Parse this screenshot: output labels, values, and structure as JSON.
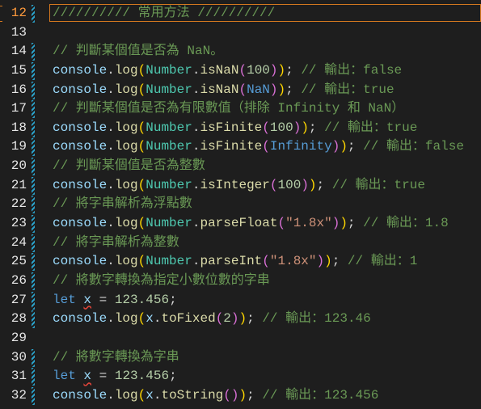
{
  "editor": {
    "current_line": 12,
    "lines": [
      {
        "num": "12",
        "tokens": [
          {
            "t": "////////// 常用方法 //////////",
            "c": "cm"
          }
        ]
      },
      {
        "num": "13",
        "tokens": []
      },
      {
        "num": "14",
        "tokens": [
          {
            "t": "// 判斷某個值是否為 NaN。",
            "c": "cm"
          }
        ]
      },
      {
        "num": "15",
        "tokens": [
          {
            "t": "console",
            "c": "var"
          },
          {
            "t": ".",
            "c": "pl"
          },
          {
            "t": "log",
            "c": "fn"
          },
          {
            "t": "(",
            "c": "p1"
          },
          {
            "t": "Number",
            "c": "cls"
          },
          {
            "t": ".",
            "c": "pl"
          },
          {
            "t": "isNaN",
            "c": "fn"
          },
          {
            "t": "(",
            "c": "p2"
          },
          {
            "t": "100",
            "c": "num"
          },
          {
            "t": ")",
            "c": "p2"
          },
          {
            "t": ")",
            "c": "p1"
          },
          {
            "t": "; ",
            "c": "pl"
          },
          {
            "t": "// 輸出：false",
            "c": "cm"
          }
        ]
      },
      {
        "num": "16",
        "tokens": [
          {
            "t": "console",
            "c": "var"
          },
          {
            "t": ".",
            "c": "pl"
          },
          {
            "t": "log",
            "c": "fn"
          },
          {
            "t": "(",
            "c": "p1"
          },
          {
            "t": "Number",
            "c": "cls"
          },
          {
            "t": ".",
            "c": "pl"
          },
          {
            "t": "isNaN",
            "c": "fn"
          },
          {
            "t": "(",
            "c": "p2"
          },
          {
            "t": "NaN",
            "c": "const"
          },
          {
            "t": ")",
            "c": "p2"
          },
          {
            "t": ")",
            "c": "p1"
          },
          {
            "t": "; ",
            "c": "pl"
          },
          {
            "t": "// 輸出：true",
            "c": "cm"
          }
        ]
      },
      {
        "num": "17",
        "tokens": [
          {
            "t": "// 判斷某個值是否為有限數值（排除 Infinity 和 NaN）",
            "c": "cm"
          }
        ]
      },
      {
        "num": "18",
        "tokens": [
          {
            "t": "console",
            "c": "var"
          },
          {
            "t": ".",
            "c": "pl"
          },
          {
            "t": "log",
            "c": "fn"
          },
          {
            "t": "(",
            "c": "p1"
          },
          {
            "t": "Number",
            "c": "cls"
          },
          {
            "t": ".",
            "c": "pl"
          },
          {
            "t": "isFinite",
            "c": "fn"
          },
          {
            "t": "(",
            "c": "p2"
          },
          {
            "t": "100",
            "c": "num"
          },
          {
            "t": ")",
            "c": "p2"
          },
          {
            "t": ")",
            "c": "p1"
          },
          {
            "t": "; ",
            "c": "pl"
          },
          {
            "t": "// 輸出：true",
            "c": "cm"
          }
        ]
      },
      {
        "num": "19",
        "tokens": [
          {
            "t": "console",
            "c": "var"
          },
          {
            "t": ".",
            "c": "pl"
          },
          {
            "t": "log",
            "c": "fn"
          },
          {
            "t": "(",
            "c": "p1"
          },
          {
            "t": "Number",
            "c": "cls"
          },
          {
            "t": ".",
            "c": "pl"
          },
          {
            "t": "isFinite",
            "c": "fn"
          },
          {
            "t": "(",
            "c": "p2"
          },
          {
            "t": "Infinity",
            "c": "const"
          },
          {
            "t": ")",
            "c": "p2"
          },
          {
            "t": ")",
            "c": "p1"
          },
          {
            "t": "; ",
            "c": "pl"
          },
          {
            "t": "// 輸出：false",
            "c": "cm"
          }
        ]
      },
      {
        "num": "20",
        "tokens": [
          {
            "t": "// 判斷某個值是否為整數",
            "c": "cm"
          }
        ]
      },
      {
        "num": "21",
        "tokens": [
          {
            "t": "console",
            "c": "var"
          },
          {
            "t": ".",
            "c": "pl"
          },
          {
            "t": "log",
            "c": "fn"
          },
          {
            "t": "(",
            "c": "p1"
          },
          {
            "t": "Number",
            "c": "cls"
          },
          {
            "t": ".",
            "c": "pl"
          },
          {
            "t": "isInteger",
            "c": "fn"
          },
          {
            "t": "(",
            "c": "p2"
          },
          {
            "t": "100",
            "c": "num"
          },
          {
            "t": ")",
            "c": "p2"
          },
          {
            "t": ")",
            "c": "p1"
          },
          {
            "t": "; ",
            "c": "pl"
          },
          {
            "t": "// 輸出：true",
            "c": "cm"
          }
        ]
      },
      {
        "num": "22",
        "tokens": [
          {
            "t": "// 將字串解析為浮點數",
            "c": "cm"
          }
        ]
      },
      {
        "num": "23",
        "tokens": [
          {
            "t": "console",
            "c": "var"
          },
          {
            "t": ".",
            "c": "pl"
          },
          {
            "t": "log",
            "c": "fn"
          },
          {
            "t": "(",
            "c": "p1"
          },
          {
            "t": "Number",
            "c": "cls"
          },
          {
            "t": ".",
            "c": "pl"
          },
          {
            "t": "parseFloat",
            "c": "fn"
          },
          {
            "t": "(",
            "c": "p2"
          },
          {
            "t": "\"1.8x\"",
            "c": "str"
          },
          {
            "t": ")",
            "c": "p2"
          },
          {
            "t": ")",
            "c": "p1"
          },
          {
            "t": "; ",
            "c": "pl"
          },
          {
            "t": "// 輸出：1.8",
            "c": "cm"
          }
        ]
      },
      {
        "num": "24",
        "tokens": [
          {
            "t": "// 將字串解析為整數",
            "c": "cm"
          }
        ]
      },
      {
        "num": "25",
        "tokens": [
          {
            "t": "console",
            "c": "var"
          },
          {
            "t": ".",
            "c": "pl"
          },
          {
            "t": "log",
            "c": "fn"
          },
          {
            "t": "(",
            "c": "p1"
          },
          {
            "t": "Number",
            "c": "cls"
          },
          {
            "t": ".",
            "c": "pl"
          },
          {
            "t": "parseInt",
            "c": "fn"
          },
          {
            "t": "(",
            "c": "p2"
          },
          {
            "t": "\"1.8x\"",
            "c": "str"
          },
          {
            "t": ")",
            "c": "p2"
          },
          {
            "t": ")",
            "c": "p1"
          },
          {
            "t": "; ",
            "c": "pl"
          },
          {
            "t": "// 輸出：1",
            "c": "cm"
          }
        ]
      },
      {
        "num": "26",
        "tokens": [
          {
            "t": "// 將數字轉換為指定小數位數的字串",
            "c": "cm"
          }
        ]
      },
      {
        "num": "27",
        "tokens": [
          {
            "t": "let",
            "c": "kw"
          },
          {
            "t": " ",
            "c": "pl"
          },
          {
            "t": "x",
            "c": "var",
            "sq": true
          },
          {
            "t": " = ",
            "c": "pl"
          },
          {
            "t": "123.456",
            "c": "num"
          },
          {
            "t": ";",
            "c": "pl"
          }
        ]
      },
      {
        "num": "28",
        "tokens": [
          {
            "t": "console",
            "c": "var"
          },
          {
            "t": ".",
            "c": "pl"
          },
          {
            "t": "log",
            "c": "fn"
          },
          {
            "t": "(",
            "c": "p1"
          },
          {
            "t": "x",
            "c": "var"
          },
          {
            "t": ".",
            "c": "pl"
          },
          {
            "t": "toFixed",
            "c": "fn"
          },
          {
            "t": "(",
            "c": "p2"
          },
          {
            "t": "2",
            "c": "num"
          },
          {
            "t": ")",
            "c": "p2"
          },
          {
            "t": ")",
            "c": "p1"
          },
          {
            "t": "; ",
            "c": "pl"
          },
          {
            "t": "// 輸出：123.46",
            "c": "cm"
          }
        ]
      },
      {
        "num": "29",
        "tokens": []
      },
      {
        "num": "30",
        "tokens": [
          {
            "t": "// 將數字轉換為字串",
            "c": "cm"
          }
        ]
      },
      {
        "num": "31",
        "tokens": [
          {
            "t": "let",
            "c": "kw"
          },
          {
            "t": " ",
            "c": "pl"
          },
          {
            "t": "x",
            "c": "var",
            "sq": true
          },
          {
            "t": " = ",
            "c": "pl"
          },
          {
            "t": "123.456",
            "c": "num"
          },
          {
            "t": ";",
            "c": "pl"
          }
        ]
      },
      {
        "num": "32",
        "tokens": [
          {
            "t": "console",
            "c": "var"
          },
          {
            "t": ".",
            "c": "pl"
          },
          {
            "t": "log",
            "c": "fn"
          },
          {
            "t": "(",
            "c": "p1"
          },
          {
            "t": "x",
            "c": "var"
          },
          {
            "t": ".",
            "c": "pl"
          },
          {
            "t": "toString",
            "c": "fn"
          },
          {
            "t": "(",
            "c": "p2"
          },
          {
            "t": ")",
            "c": "p2"
          },
          {
            "t": ")",
            "c": "p1"
          },
          {
            "t": "; ",
            "c": "pl"
          },
          {
            "t": "// 輸出：123.456",
            "c": "cm"
          }
        ]
      }
    ]
  }
}
